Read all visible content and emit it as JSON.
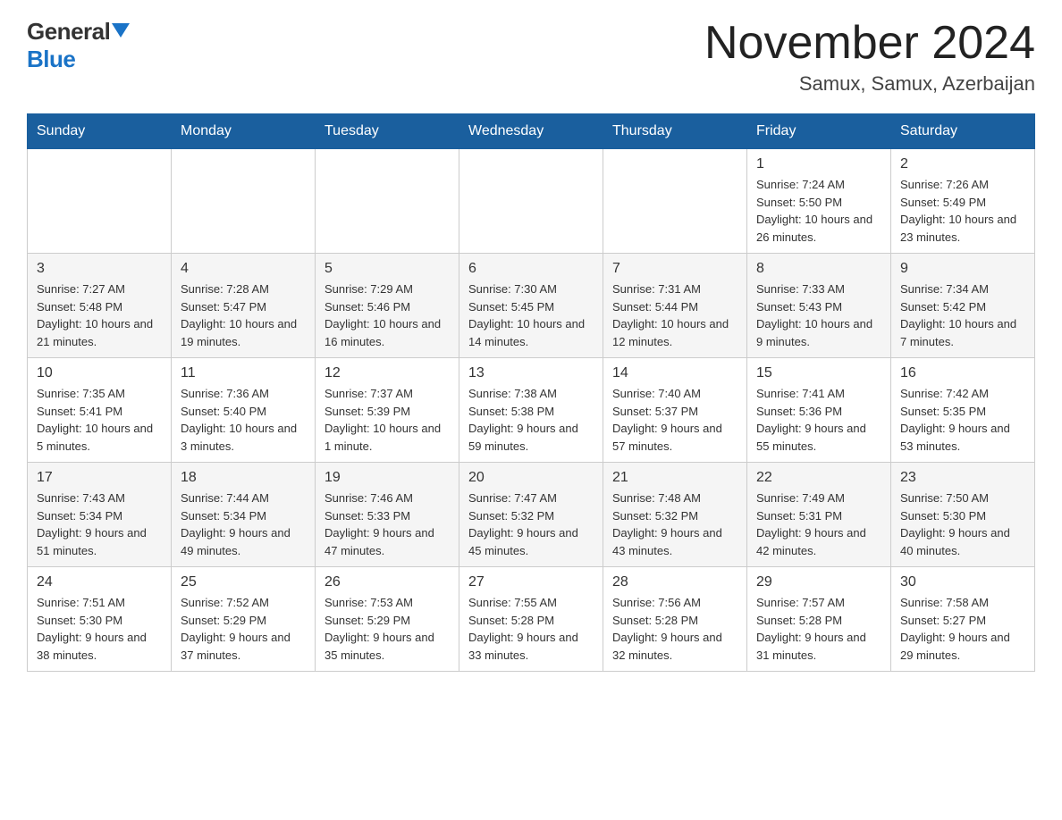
{
  "logo": {
    "general": "General",
    "blue": "Blue"
  },
  "title": "November 2024",
  "location": "Samux, Samux, Azerbaijan",
  "days_of_week": [
    "Sunday",
    "Monday",
    "Tuesday",
    "Wednesday",
    "Thursday",
    "Friday",
    "Saturday"
  ],
  "weeks": [
    [
      {
        "day": "",
        "info": ""
      },
      {
        "day": "",
        "info": ""
      },
      {
        "day": "",
        "info": ""
      },
      {
        "day": "",
        "info": ""
      },
      {
        "day": "",
        "info": ""
      },
      {
        "day": "1",
        "info": "Sunrise: 7:24 AM\nSunset: 5:50 PM\nDaylight: 10 hours and 26 minutes."
      },
      {
        "day": "2",
        "info": "Sunrise: 7:26 AM\nSunset: 5:49 PM\nDaylight: 10 hours and 23 minutes."
      }
    ],
    [
      {
        "day": "3",
        "info": "Sunrise: 7:27 AM\nSunset: 5:48 PM\nDaylight: 10 hours and 21 minutes."
      },
      {
        "day": "4",
        "info": "Sunrise: 7:28 AM\nSunset: 5:47 PM\nDaylight: 10 hours and 19 minutes."
      },
      {
        "day": "5",
        "info": "Sunrise: 7:29 AM\nSunset: 5:46 PM\nDaylight: 10 hours and 16 minutes."
      },
      {
        "day": "6",
        "info": "Sunrise: 7:30 AM\nSunset: 5:45 PM\nDaylight: 10 hours and 14 minutes."
      },
      {
        "day": "7",
        "info": "Sunrise: 7:31 AM\nSunset: 5:44 PM\nDaylight: 10 hours and 12 minutes."
      },
      {
        "day": "8",
        "info": "Sunrise: 7:33 AM\nSunset: 5:43 PM\nDaylight: 10 hours and 9 minutes."
      },
      {
        "day": "9",
        "info": "Sunrise: 7:34 AM\nSunset: 5:42 PM\nDaylight: 10 hours and 7 minutes."
      }
    ],
    [
      {
        "day": "10",
        "info": "Sunrise: 7:35 AM\nSunset: 5:41 PM\nDaylight: 10 hours and 5 minutes."
      },
      {
        "day": "11",
        "info": "Sunrise: 7:36 AM\nSunset: 5:40 PM\nDaylight: 10 hours and 3 minutes."
      },
      {
        "day": "12",
        "info": "Sunrise: 7:37 AM\nSunset: 5:39 PM\nDaylight: 10 hours and 1 minute."
      },
      {
        "day": "13",
        "info": "Sunrise: 7:38 AM\nSunset: 5:38 PM\nDaylight: 9 hours and 59 minutes."
      },
      {
        "day": "14",
        "info": "Sunrise: 7:40 AM\nSunset: 5:37 PM\nDaylight: 9 hours and 57 minutes."
      },
      {
        "day": "15",
        "info": "Sunrise: 7:41 AM\nSunset: 5:36 PM\nDaylight: 9 hours and 55 minutes."
      },
      {
        "day": "16",
        "info": "Sunrise: 7:42 AM\nSunset: 5:35 PM\nDaylight: 9 hours and 53 minutes."
      }
    ],
    [
      {
        "day": "17",
        "info": "Sunrise: 7:43 AM\nSunset: 5:34 PM\nDaylight: 9 hours and 51 minutes."
      },
      {
        "day": "18",
        "info": "Sunrise: 7:44 AM\nSunset: 5:34 PM\nDaylight: 9 hours and 49 minutes."
      },
      {
        "day": "19",
        "info": "Sunrise: 7:46 AM\nSunset: 5:33 PM\nDaylight: 9 hours and 47 minutes."
      },
      {
        "day": "20",
        "info": "Sunrise: 7:47 AM\nSunset: 5:32 PM\nDaylight: 9 hours and 45 minutes."
      },
      {
        "day": "21",
        "info": "Sunrise: 7:48 AM\nSunset: 5:32 PM\nDaylight: 9 hours and 43 minutes."
      },
      {
        "day": "22",
        "info": "Sunrise: 7:49 AM\nSunset: 5:31 PM\nDaylight: 9 hours and 42 minutes."
      },
      {
        "day": "23",
        "info": "Sunrise: 7:50 AM\nSunset: 5:30 PM\nDaylight: 9 hours and 40 minutes."
      }
    ],
    [
      {
        "day": "24",
        "info": "Sunrise: 7:51 AM\nSunset: 5:30 PM\nDaylight: 9 hours and 38 minutes."
      },
      {
        "day": "25",
        "info": "Sunrise: 7:52 AM\nSunset: 5:29 PM\nDaylight: 9 hours and 37 minutes."
      },
      {
        "day": "26",
        "info": "Sunrise: 7:53 AM\nSunset: 5:29 PM\nDaylight: 9 hours and 35 minutes."
      },
      {
        "day": "27",
        "info": "Sunrise: 7:55 AM\nSunset: 5:28 PM\nDaylight: 9 hours and 33 minutes."
      },
      {
        "day": "28",
        "info": "Sunrise: 7:56 AM\nSunset: 5:28 PM\nDaylight: 9 hours and 32 minutes."
      },
      {
        "day": "29",
        "info": "Sunrise: 7:57 AM\nSunset: 5:28 PM\nDaylight: 9 hours and 31 minutes."
      },
      {
        "day": "30",
        "info": "Sunrise: 7:58 AM\nSunset: 5:27 PM\nDaylight: 9 hours and 29 minutes."
      }
    ]
  ]
}
